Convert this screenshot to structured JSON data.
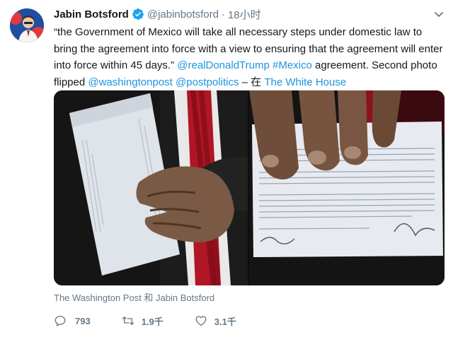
{
  "author": {
    "name": "Jabin Botsford",
    "handle": "@jabinbotsford",
    "separator": "·",
    "time": "18小时",
    "verified": true,
    "verified_color": "#1da1f2"
  },
  "tweet": {
    "quote": "“the Government of Mexico will take all necessary steps under domestic law to bring the agreement into force with a view to ensuring that the agreement will enter into force within 45 days.”",
    "mention_trump": "@realDonaldTrump",
    "hashtag_mexico": "#Mexico",
    "mid_text": "agreement. Second photo flipped",
    "mention_wapo": "@washingtonpost",
    "mention_postpolitics": "@postpolitics",
    "location_prefix": "– 在",
    "location": "The White House",
    "link_color": "#1b95e0"
  },
  "media": {
    "photo_1_subject": "hand holding folded agreement document",
    "photo_2_subject": "flipped view of signed agreement page"
  },
  "caption": "The Washington Post 和 Jabin Botsford",
  "actions": {
    "replies": "793",
    "retweets": "1.9千",
    "likes": "3.1千"
  },
  "icons": {
    "reply": "reply-icon",
    "retweet": "retweet-icon",
    "like": "heart-icon",
    "more": "chevron-down-icon",
    "verified": "verified-badge-icon"
  }
}
